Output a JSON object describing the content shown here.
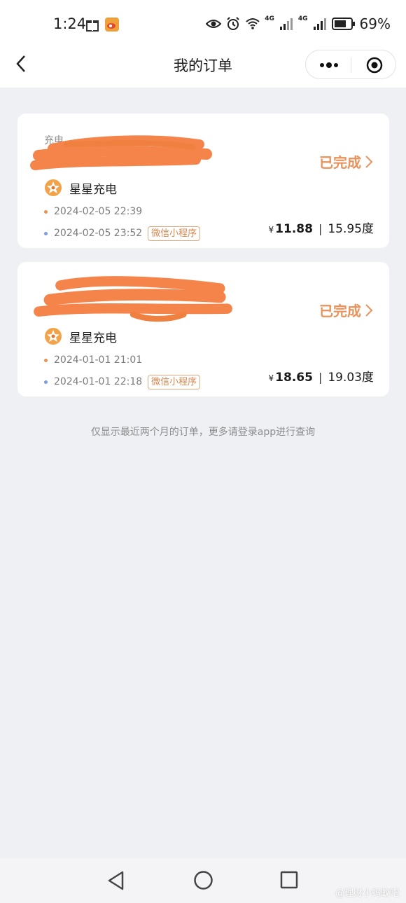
{
  "status_bar": {
    "time": "1:24",
    "network_1": "4G",
    "network_2": "4G",
    "battery": "69%",
    "icons": [
      "gift-icon",
      "weibo-icon",
      "eye-icon",
      "alarm-icon",
      "wifi-icon",
      "signal-icon",
      "signal-icon",
      "battery-icon"
    ]
  },
  "nav": {
    "title": "我的订单",
    "icons": [
      "back-icon",
      "more-icon",
      "close-icon"
    ]
  },
  "orders": [
    {
      "label_partial": "充电",
      "status": "已完成",
      "brand": "星星充电",
      "start_time": "2024-02-05 22:39",
      "end_time": "2024-02-05 23:52",
      "channel": "微信小程序",
      "currency": "¥",
      "price": "11.88",
      "energy": "15.95度"
    },
    {
      "label_partial": "",
      "status": "已完成",
      "brand": "星星充电",
      "start_time": "2024-01-01 21:01",
      "end_time": "2024-01-01 22:18",
      "channel": "微信小程序",
      "currency": "¥",
      "price": "18.65",
      "energy": "19.03度"
    }
  ],
  "footer_note": "仅显示最近两个月的订单，更多请登录app进行查询",
  "watermark": "@理财小蚂蚁吧",
  "colors": {
    "accent_orange": "#e8925c",
    "background": "#eff0f4",
    "redaction": "#f5844a"
  }
}
